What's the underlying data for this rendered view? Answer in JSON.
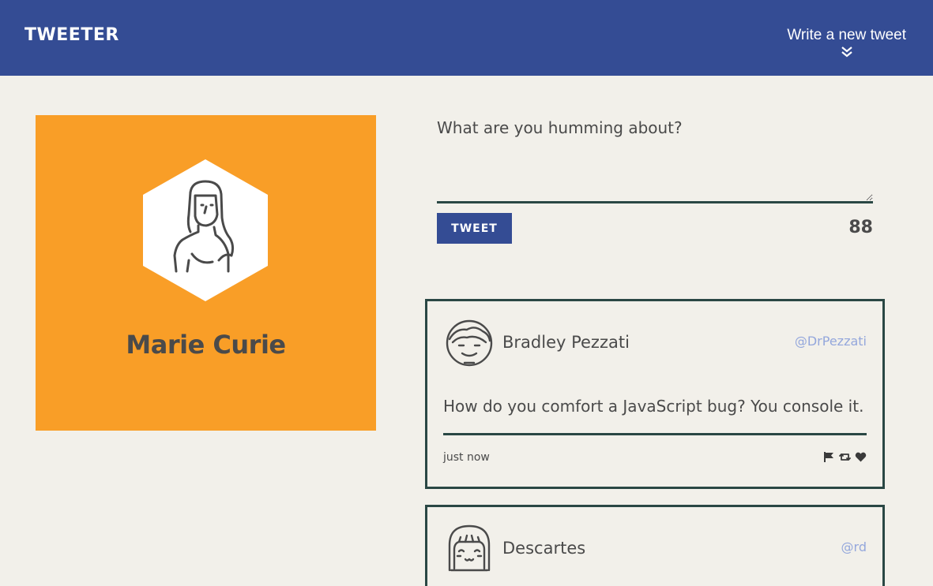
{
  "nav": {
    "brand": "Tweeter",
    "compose_label": "Write a new tweet",
    "compose_icon": "double-chevron-down-icon"
  },
  "profile": {
    "name": "Marie Curie",
    "avatar_icon": "woman-avatar-icon",
    "background_color": "#f99e27"
  },
  "new_tweet": {
    "placeholder": "What are you humming about?",
    "value": "",
    "button_label": "Tweet",
    "counter": "88"
  },
  "tweets": [
    {
      "name": "Bradley Pezzati",
      "handle": "@DrPezzati",
      "content": "How do you comfort a JavaScript bug? You console it.",
      "time": "just now",
      "avatar_icon": "man-avatar-icon",
      "actions": [
        "flag-icon",
        "retweet-icon",
        "heart-icon"
      ]
    },
    {
      "name": "Descartes",
      "handle": "@rd",
      "avatar_icon": "girl-avatar-icon"
    }
  ],
  "colors": {
    "nav": "#344c94",
    "accent": "#f99e27",
    "border": "#2a4744",
    "handle": "#94a7dc",
    "background": "#f2f0ea"
  }
}
